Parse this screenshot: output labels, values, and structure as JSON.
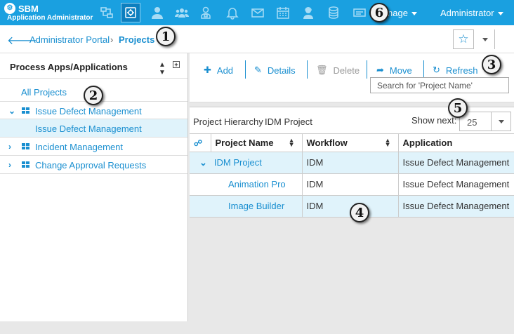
{
  "header": {
    "brand_name": "SBM",
    "brand_sub": "Application Administrator",
    "manage_label": "nage",
    "admin_label": "Administrator",
    "colors": {
      "bar": "#1aa0e0",
      "active": "#0d7fbf"
    },
    "nav_icons": [
      "process-apps-icon",
      "projects-icon",
      "user-icon",
      "groups-icon",
      "role-icon",
      "notification-bell-icon",
      "mail-icon",
      "calendar-icon",
      "support-user-icon",
      "database-icon",
      "import-export-icon"
    ]
  },
  "breadcrumb": {
    "portal": "Administrator Portal",
    "separator": "›",
    "current": "Projects"
  },
  "left_panel": {
    "title": "Process Apps/Applications",
    "all_projects": "All Projects",
    "items": [
      {
        "label": "Issue Defect Management",
        "expanded": true
      },
      {
        "label": "Issue Defect Management",
        "child": true
      },
      {
        "label": "Incident Management"
      },
      {
        "label": "Change Approval Requests"
      }
    ]
  },
  "toolbar": {
    "add": "Add",
    "details": "Details",
    "delete": "Delete",
    "move": "Move",
    "refresh": "Refresh",
    "search_placeholder": "Search for 'Project Name'"
  },
  "grid": {
    "hierarchy_label": "Project Hierarchy",
    "hierarchy_value": "IDM Project",
    "show_next_label": "Show next:",
    "show_next_value": "25",
    "columns": [
      "Project Name",
      "Workflow",
      "Application"
    ],
    "rows": [
      {
        "name": "IDM Project",
        "workflow": "IDM",
        "application": "Issue Defect Management"
      },
      {
        "name": "Animation Pro",
        "workflow": "IDM",
        "application": "Issue Defect Management"
      },
      {
        "name": "Image Builder",
        "workflow": "IDM",
        "application": "Issue Defect Management"
      }
    ]
  },
  "callouts": [
    "1",
    "2",
    "3",
    "4",
    "5",
    "6"
  ]
}
